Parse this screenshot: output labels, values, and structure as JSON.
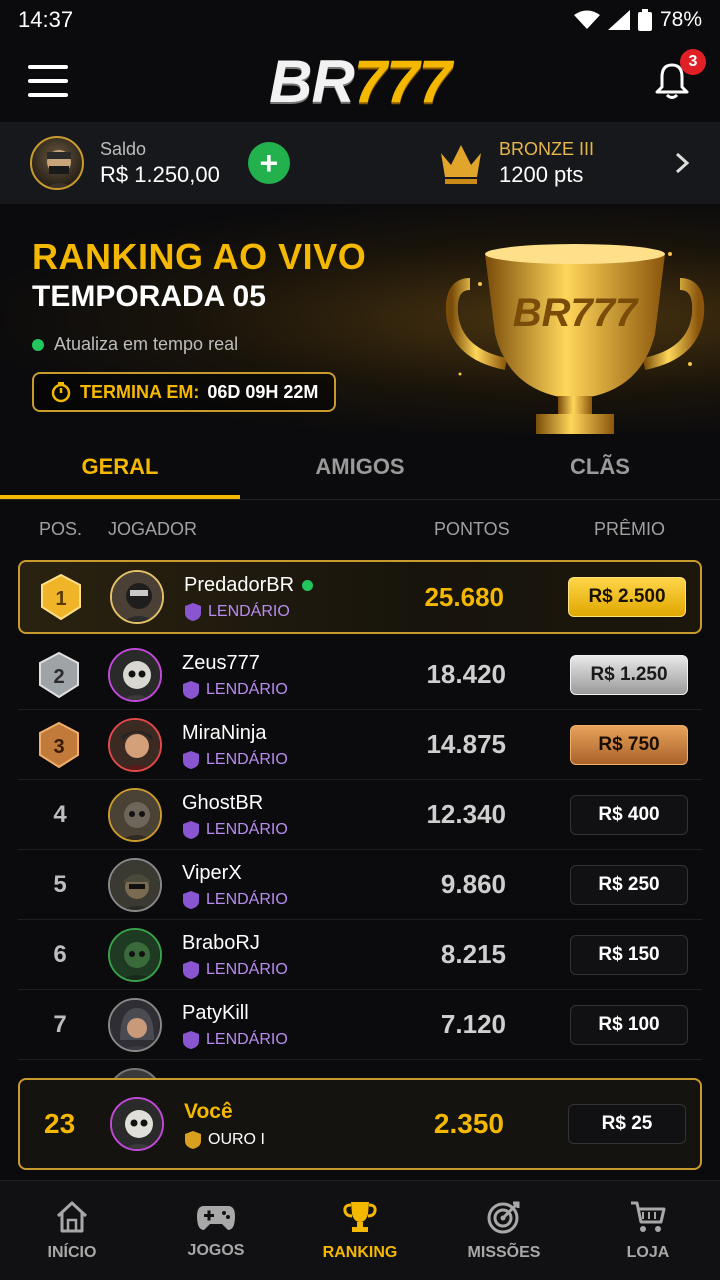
{
  "status_bar": {
    "time": "14:37",
    "battery": "78%"
  },
  "header": {
    "logo_br": "BR",
    "logo_num": "777",
    "notifications": "3"
  },
  "account": {
    "balance_label": "Saldo",
    "balance_value": "R$ 1.250,00",
    "rank_name": "BRONZE III",
    "rank_points": "1200 pts"
  },
  "hero": {
    "title": "RANKING AO VIVO",
    "subtitle": "TEMPORADA 05",
    "live_text": "Atualiza em tempo real",
    "timer_label": "TERMINA EM:",
    "timer_value": "06D 09H 22M",
    "trophy_text": "BR777"
  },
  "tabs": [
    {
      "label": "GERAL"
    },
    {
      "label": "AMIGOS"
    },
    {
      "label": "CLÃS"
    }
  ],
  "columns": {
    "pos": "POS.",
    "player": "JOGADOR",
    "points": "PONTOS",
    "prize": "PRÊMIO"
  },
  "rows": [
    {
      "pos": "1",
      "name": "PredadorBR",
      "tier": "LENDÁRIO",
      "points": "25.680",
      "prize": "R$ 2.500"
    },
    {
      "pos": "2",
      "name": "Zeus777",
      "tier": "LENDÁRIO",
      "points": "18.420",
      "prize": "R$ 1.250"
    },
    {
      "pos": "3",
      "name": "MiraNinja",
      "tier": "LENDÁRIO",
      "points": "14.875",
      "prize": "R$ 750"
    },
    {
      "pos": "4",
      "name": "GhostBR",
      "tier": "LENDÁRIO",
      "points": "12.340",
      "prize": "R$ 400"
    },
    {
      "pos": "5",
      "name": "ViperX",
      "tier": "LENDÁRIO",
      "points": "9.860",
      "prize": "R$ 250"
    },
    {
      "pos": "6",
      "name": "BraboRJ",
      "tier": "LENDÁRIO",
      "points": "8.215",
      "prize": "R$ 150"
    },
    {
      "pos": "7",
      "name": "PatyKill",
      "tier": "LENDÁRIO",
      "points": "7.120",
      "prize": "R$ 100"
    }
  ],
  "you": {
    "pos": "23",
    "name": "Você",
    "tier": "OURO I",
    "points": "2.350",
    "prize": "R$ 25"
  },
  "nav": [
    {
      "label": "INÍCIO"
    },
    {
      "label": "JOGOS"
    },
    {
      "label": "RANKING"
    },
    {
      "label": "MISSÕES"
    },
    {
      "label": "LOJA"
    }
  ],
  "colors": {
    "accent": "#f5b800",
    "online": "#22c55e",
    "legendary": "#b88cf0",
    "add": "#22b14c",
    "badge": "#e01f26"
  }
}
